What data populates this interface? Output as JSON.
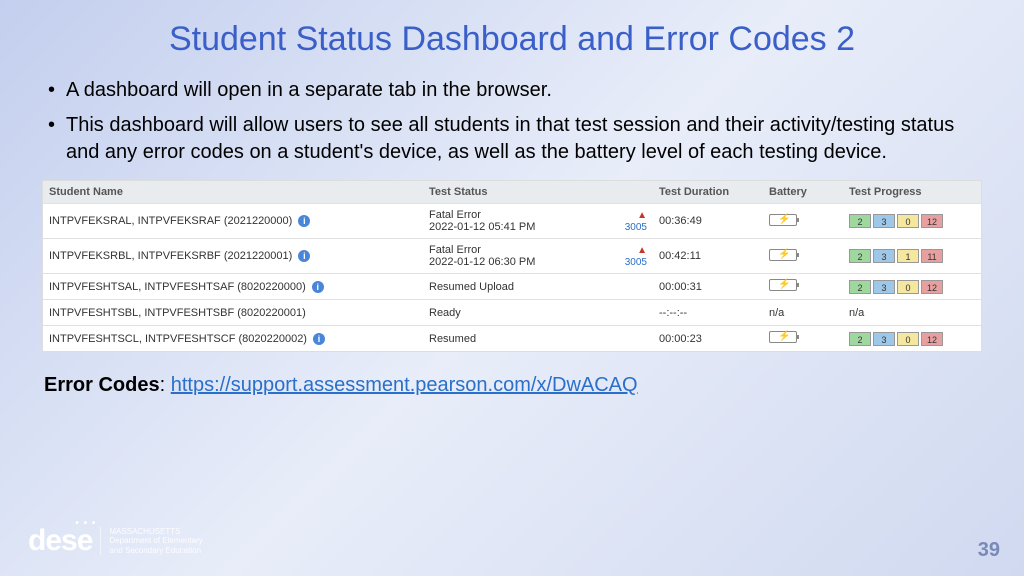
{
  "title": "Student Status Dashboard and Error Codes 2",
  "bullets": [
    "A dashboard will open in a separate tab in the browser.",
    "This dashboard will allow users to see all students in that test session and their activity/testing status and any error codes on a student's device, as well as the battery level of each testing device."
  ],
  "headers": {
    "name": "Student Name",
    "status": "Test Status",
    "dur": "Test Duration",
    "bat": "Battery",
    "prog": "Test Progress"
  },
  "rows": [
    {
      "name": "INTPVFEKSRAL, INTPVFEKSRAF (2021220000)",
      "info": true,
      "status_l1": "Fatal Error",
      "status_l2": "2022-01-12 05:41 PM",
      "err": "3005",
      "dur": "00:36:49",
      "bat": "icon",
      "prog": [
        "2",
        "3",
        "0",
        "12"
      ]
    },
    {
      "name": "INTPVFEKSRBL, INTPVFEKSRBF (2021220001)",
      "info": true,
      "status_l1": "Fatal Error",
      "status_l2": "2022-01-12 06:30 PM",
      "err": "3005",
      "dur": "00:42:11",
      "bat": "icon",
      "prog": [
        "2",
        "3",
        "1",
        "11"
      ]
    },
    {
      "name": "INTPVFESHTSAL, INTPVFESHTSAF (8020220000)",
      "info": true,
      "status_l1": "Resumed Upload",
      "status_l2": "",
      "err": "",
      "dur": "00:00:31",
      "bat": "icon",
      "prog": [
        "2",
        "3",
        "0",
        "12"
      ]
    },
    {
      "name": "INTPVFESHTSBL, INTPVFESHTSBF (8020220001)",
      "info": false,
      "status_l1": "Ready",
      "status_l2": "",
      "err": "",
      "dur": "--:--:--",
      "bat": "n/a",
      "prog": null,
      "prog_text": "n/a"
    },
    {
      "name": "INTPVFESHTSCL, INTPVFESHTSCF (8020220002)",
      "info": true,
      "status_l1": "Resumed",
      "status_l2": "",
      "err": "",
      "dur": "00:00:23",
      "bat": "icon",
      "prog": [
        "2",
        "3",
        "0",
        "12"
      ]
    }
  ],
  "link_label": "Error Codes",
  "link_url": "https://support.assessment.pearson.com/x/DwACAQ",
  "logo": {
    "mark": "dese",
    "l1": "MASSACHUSETTS",
    "l2": "Department of Elementary",
    "l3": "and Secondary Education"
  },
  "page": "39"
}
